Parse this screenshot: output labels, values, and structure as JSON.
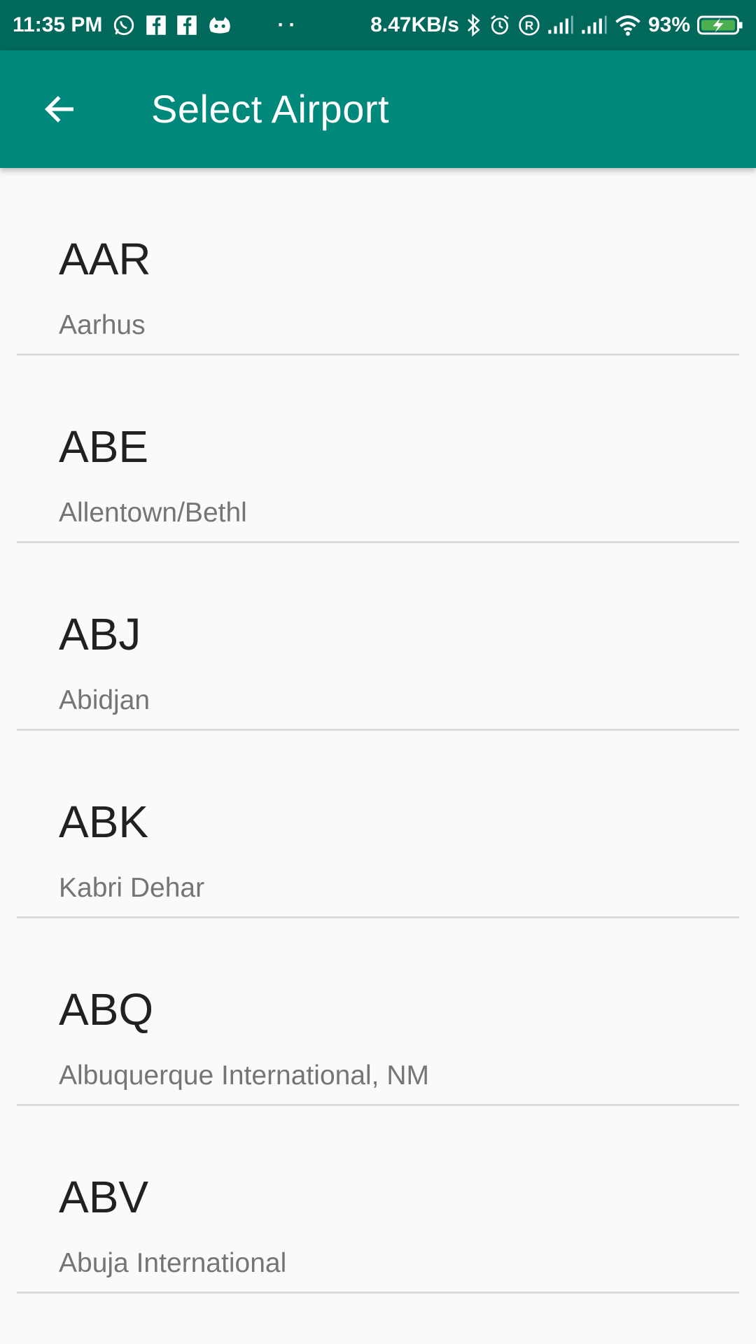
{
  "status_bar": {
    "time": "11:35 PM",
    "net_speed": "8.47KB/s",
    "battery": "93%",
    "icons": [
      "whatsapp-icon",
      "facebook-icon",
      "facebook-icon",
      "game-controller-icon",
      "more-dots-icon",
      "bluetooth-icon",
      "alarm-icon",
      "registered-icon",
      "signal-icon",
      "signal-icon",
      "wifi-icon",
      "battery-charging-icon"
    ]
  },
  "app_bar": {
    "title": "Select Airport",
    "back_icon": "arrow-back-icon",
    "color": "#00897b"
  },
  "airports": [
    {
      "code": "AAR",
      "city": "Aarhus"
    },
    {
      "code": "ABE",
      "city": "Allentown/Bethl"
    },
    {
      "code": "ABJ",
      "city": "Abidjan"
    },
    {
      "code": "ABK",
      "city": "Kabri Dehar"
    },
    {
      "code": "ABQ",
      "city": "Albuquerque International, NM"
    },
    {
      "code": "ABV",
      "city": "Abuja International"
    }
  ]
}
